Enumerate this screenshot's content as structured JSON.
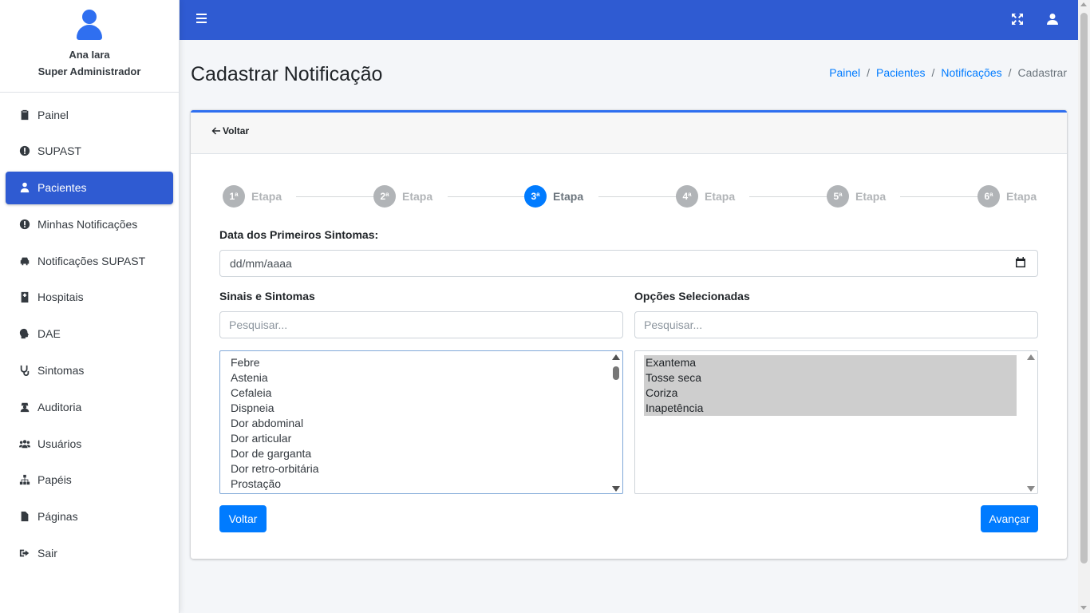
{
  "user": {
    "name": "Ana Iara",
    "role": "Super Administrador"
  },
  "sidebar": {
    "items": [
      {
        "label": "Painel",
        "icon": "clipboard-icon"
      },
      {
        "label": "SUPAST",
        "icon": "exclamation-circle-icon"
      },
      {
        "label": "Pacientes",
        "icon": "user-injured-icon",
        "active": true
      },
      {
        "label": "Minhas Notificações",
        "icon": "exclamation-circle-icon"
      },
      {
        "label": "Notificações SUPAST",
        "icon": "car-icon"
      },
      {
        "label": "Hospitais",
        "icon": "hospital-icon"
      },
      {
        "label": "DAE",
        "icon": "head-virus-icon"
      },
      {
        "label": "Sintomas",
        "icon": "stethoscope-icon"
      },
      {
        "label": "Auditoria",
        "icon": "user-secret-icon"
      },
      {
        "label": "Usuários",
        "icon": "users-icon"
      },
      {
        "label": "Papéis",
        "icon": "sitemap-icon"
      },
      {
        "label": "Páginas",
        "icon": "file-icon"
      },
      {
        "label": "Sair",
        "icon": "sign-out-icon"
      }
    ]
  },
  "colors": {
    "topbar": "#2f5bd2",
    "primary": "#007bff",
    "step_inactive": "#b1b4b7"
  },
  "page": {
    "title": "Cadastrar Notificação"
  },
  "breadcrumb": {
    "items": [
      "Painel",
      "Pacientes",
      "Notificações"
    ],
    "current": "Cadastrar"
  },
  "card": {
    "back_label": "Voltar"
  },
  "steps": {
    "items": [
      {
        "number": "1ª",
        "label": "Etapa"
      },
      {
        "number": "2ª",
        "label": "Etapa"
      },
      {
        "number": "3ª",
        "label": "Etapa",
        "active": true
      },
      {
        "number": "4ª",
        "label": "Etapa"
      },
      {
        "number": "5ª",
        "label": "Etapa"
      },
      {
        "number": "6ª",
        "label": "Etapa"
      }
    ]
  },
  "form": {
    "first_symptoms_label": "Data dos Primeiros Sintomas:",
    "first_symptoms_value": "dd/mm/aaaa",
    "signs_label": "Sinais e Sintomas",
    "selected_label": "Opções Selecionadas",
    "search_placeholder": "Pesquisar...",
    "signs_options": [
      "Febre",
      "Astenia",
      "Cefaleia",
      "Dispneia",
      "Dor abdominal",
      "Dor articular",
      "Dor de garganta",
      "Dor retro-orbitária",
      "Prostação"
    ],
    "selected_options": [
      "Exantema",
      "Tosse seca",
      "Coriza",
      "Inapetência"
    ],
    "back_button": "Voltar",
    "next_button": "Avançar"
  }
}
